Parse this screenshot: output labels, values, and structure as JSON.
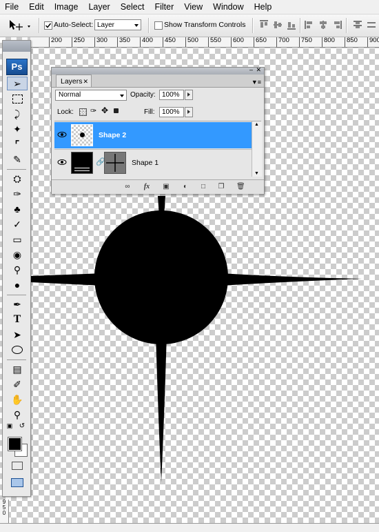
{
  "menu": [
    "File",
    "Edit",
    "Image",
    "Layer",
    "Select",
    "Filter",
    "View",
    "Window",
    "Help"
  ],
  "options_bar": {
    "auto_select_label": "Auto-Select:",
    "auto_select_checked": true,
    "auto_select_target": "Layer",
    "show_transform_label": "Show Transform Controls",
    "show_transform_checked": false
  },
  "ruler": {
    "ticks": [
      "200",
      "250",
      "300",
      "350",
      "400",
      "450",
      "500",
      "550",
      "600",
      "650",
      "700",
      "750",
      "800",
      "850",
      "900",
      "95"
    ],
    "vertical_bottom": [
      "9",
      "5",
      "0"
    ]
  },
  "toolbox": {
    "logo": "Ps"
  },
  "layers_panel": {
    "tab_label": "Layers",
    "blend_mode": "Normal",
    "opacity_label": "Opacity:",
    "opacity_value": "100%",
    "lock_label": "Lock:",
    "fill_label": "Fill:",
    "fill_value": "100%",
    "layers": [
      {
        "name": "Shape 2",
        "selected": true,
        "visible": true
      },
      {
        "name": "Shape 1",
        "selected": false,
        "visible": true
      }
    ]
  },
  "colors": {
    "foreground": "#000000",
    "background": "#ffffff",
    "selection": "#3399ff"
  }
}
